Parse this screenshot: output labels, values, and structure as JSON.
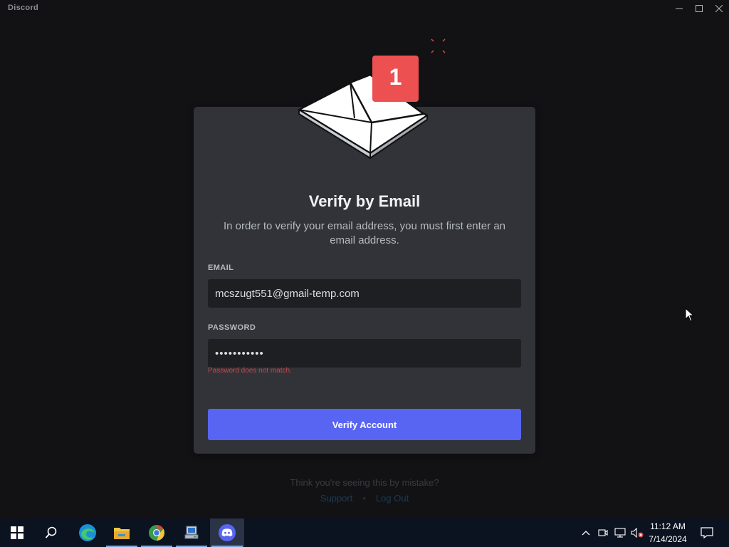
{
  "window": {
    "app_name": "Discord",
    "controls": [
      "minimize",
      "maximize",
      "close"
    ]
  },
  "illustration": {
    "icon": "envelope-icon",
    "badge_count": "1",
    "badge_color": "#ed5050"
  },
  "card": {
    "title": "Verify by Email",
    "description": "In order to verify your email address, you must first enter an email address.",
    "email_label": "EMAIL",
    "email_value": "mcszugt551@gmail-temp.com",
    "password_label": "PASSWORD",
    "password_value": "•••••••••••",
    "error_message": "Password does not match.",
    "verify_button": "Verify Account"
  },
  "footer": {
    "prompt": "Think you're seeing this by mistake?",
    "support_link": "Support",
    "separator": "•",
    "logout_link": "Log Out"
  },
  "taskbar": {
    "apps": [
      "windows-start-icon",
      "search-icon",
      "edge-icon",
      "file-explorer-icon",
      "chrome-icon",
      "computer-icon",
      "discord-icon"
    ],
    "time": "11:12 AM",
    "date": "7/14/2024"
  },
  "colors": {
    "background": "#121214",
    "card": "#313338",
    "input": "#1e1f22",
    "accent": "#5865f2",
    "error": "#c2494b"
  }
}
